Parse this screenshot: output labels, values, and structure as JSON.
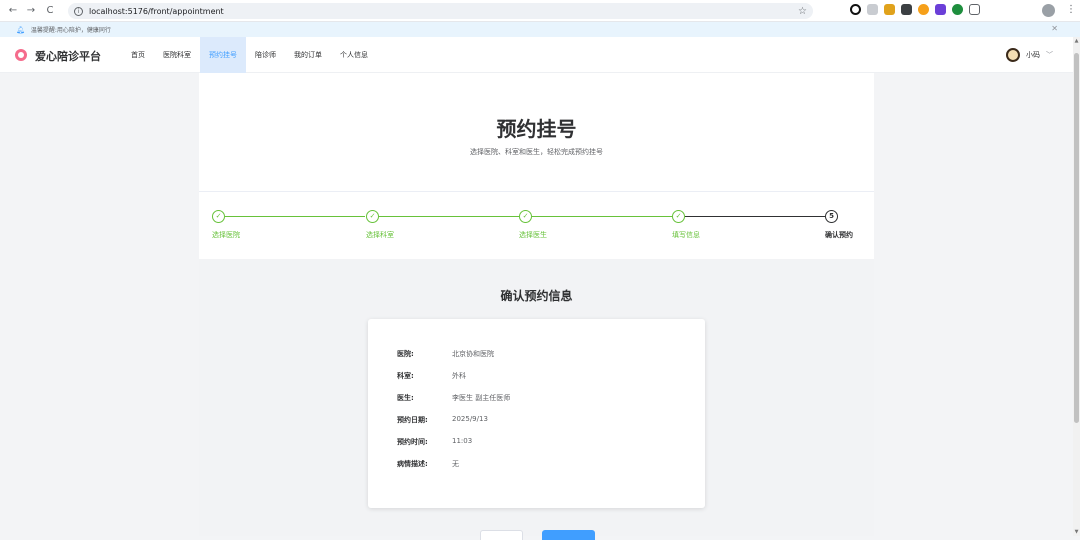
{
  "browser": {
    "url": "localhost:5176/front/appointment"
  },
  "notice": {
    "text": "温馨提醒:用心陪护，健康同行"
  },
  "header": {
    "logo": "爱心陪诊平台",
    "menu": [
      {
        "label": "首页",
        "active": false
      },
      {
        "label": "医院科室",
        "active": false
      },
      {
        "label": "预约挂号",
        "active": true
      },
      {
        "label": "陪诊师",
        "active": false
      },
      {
        "label": "我的订单",
        "active": false
      },
      {
        "label": "个人信息",
        "active": false
      }
    ],
    "user_name": "小码"
  },
  "page": {
    "title": "预约挂号",
    "subtitle": "选择医院、科室和医生，轻松完成预约挂号"
  },
  "steps": [
    {
      "label": "选择医院",
      "status": "done"
    },
    {
      "label": "选择科室",
      "status": "done"
    },
    {
      "label": "选择医生",
      "status": "done"
    },
    {
      "label": "填写信息",
      "status": "done"
    },
    {
      "label": "确认预约",
      "status": "current",
      "number": "5"
    }
  ],
  "confirm": {
    "title": "确认预约信息",
    "rows": [
      {
        "key": "医院:",
        "value": "北京协和医院"
      },
      {
        "key": "科室:",
        "value": "外科"
      },
      {
        "key": "医生:",
        "value": "李医生 副主任医师"
      },
      {
        "key": "预约日期:",
        "value": "2025/9/13"
      },
      {
        "key": "预约时间:",
        "value": "11:03"
      },
      {
        "key": "病情描述:",
        "value": "无"
      }
    ]
  },
  "colors": {
    "primary": "#409eff",
    "success": "#67c23a",
    "logo": "#f56c8c"
  }
}
